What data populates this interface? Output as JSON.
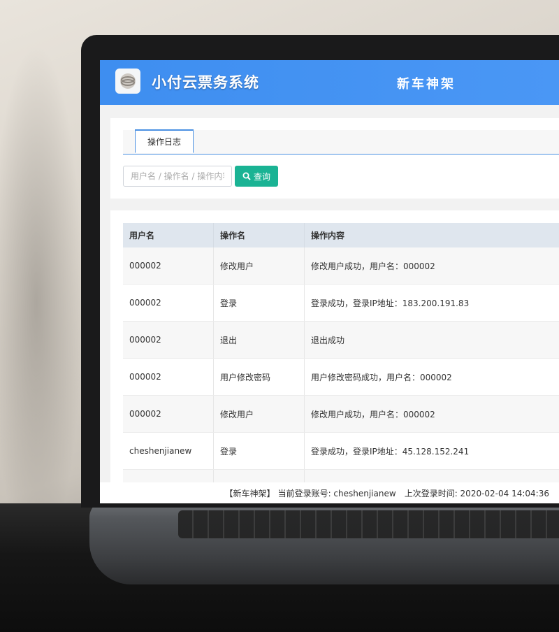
{
  "header": {
    "app_title": "小付云票务系统",
    "company": "新车神架",
    "logo_icon": "ring-logo-icon"
  },
  "tabs": [
    {
      "label": "操作日志",
      "active": true
    }
  ],
  "search": {
    "placeholder": "用户名 / 操作名 / 操作内容",
    "button_label": "查询",
    "button_icon": "search-icon",
    "button_color": "#1ab394"
  },
  "table": {
    "columns": [
      "用户名",
      "操作名",
      "操作内容"
    ],
    "rows": [
      {
        "user": "000002",
        "action": "修改用户",
        "content": "修改用户成功，用户名：000002"
      },
      {
        "user": "000002",
        "action": "登录",
        "content": "登录成功，登录IP地址：183.200.191.83"
      },
      {
        "user": "000002",
        "action": "退出",
        "content": "退出成功"
      },
      {
        "user": "000002",
        "action": "用户修改密码",
        "content": "用户修改密码成功，用户名：000002"
      },
      {
        "user": "000002",
        "action": "修改用户",
        "content": "修改用户成功，用户名：000002"
      },
      {
        "user": "cheshenjianew",
        "action": "登录",
        "content": "登录成功，登录IP地址：45.128.152.241"
      }
    ]
  },
  "footer": {
    "company_tag": "【新车神架】",
    "account_text": "当前登录账号: cheshenjianew",
    "last_login_text": "上次登录时间: 2020-02-04 14:04:36"
  },
  "colors": {
    "header_blue": "#3e8ef0",
    "table_header": "#dfe6ee",
    "accent_border": "#4a90e2"
  }
}
